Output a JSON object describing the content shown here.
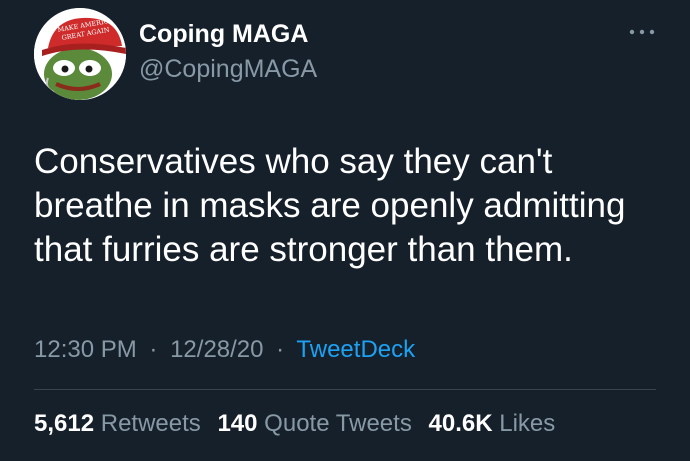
{
  "user": {
    "display_name": "Coping MAGA",
    "handle": "@CopingMAGA",
    "avatar_hat_text_line1": "MAKE AMERICA",
    "avatar_hat_text_line2": "GREAT AGAIN"
  },
  "tweet": {
    "text_lines": [
      "Conservatives who say they can't",
      "breathe in masks are openly admitting",
      "that furries are stronger than them."
    ],
    "time": "12:30 PM",
    "date": "12/28/20",
    "separator": "·",
    "source": "TweetDeck"
  },
  "stats": {
    "retweets_count": "5,612",
    "retweets_label": "Retweets",
    "quote_count": "140",
    "quote_label": "Quote Tweets",
    "likes_count": "40.6K",
    "likes_label": "Likes"
  },
  "icons": {
    "more": "more-horizontal-icon"
  },
  "colors": {
    "background": "#15202b",
    "secondary_text": "#8899a6",
    "link": "#1da1f2",
    "divider": "#38444d"
  }
}
